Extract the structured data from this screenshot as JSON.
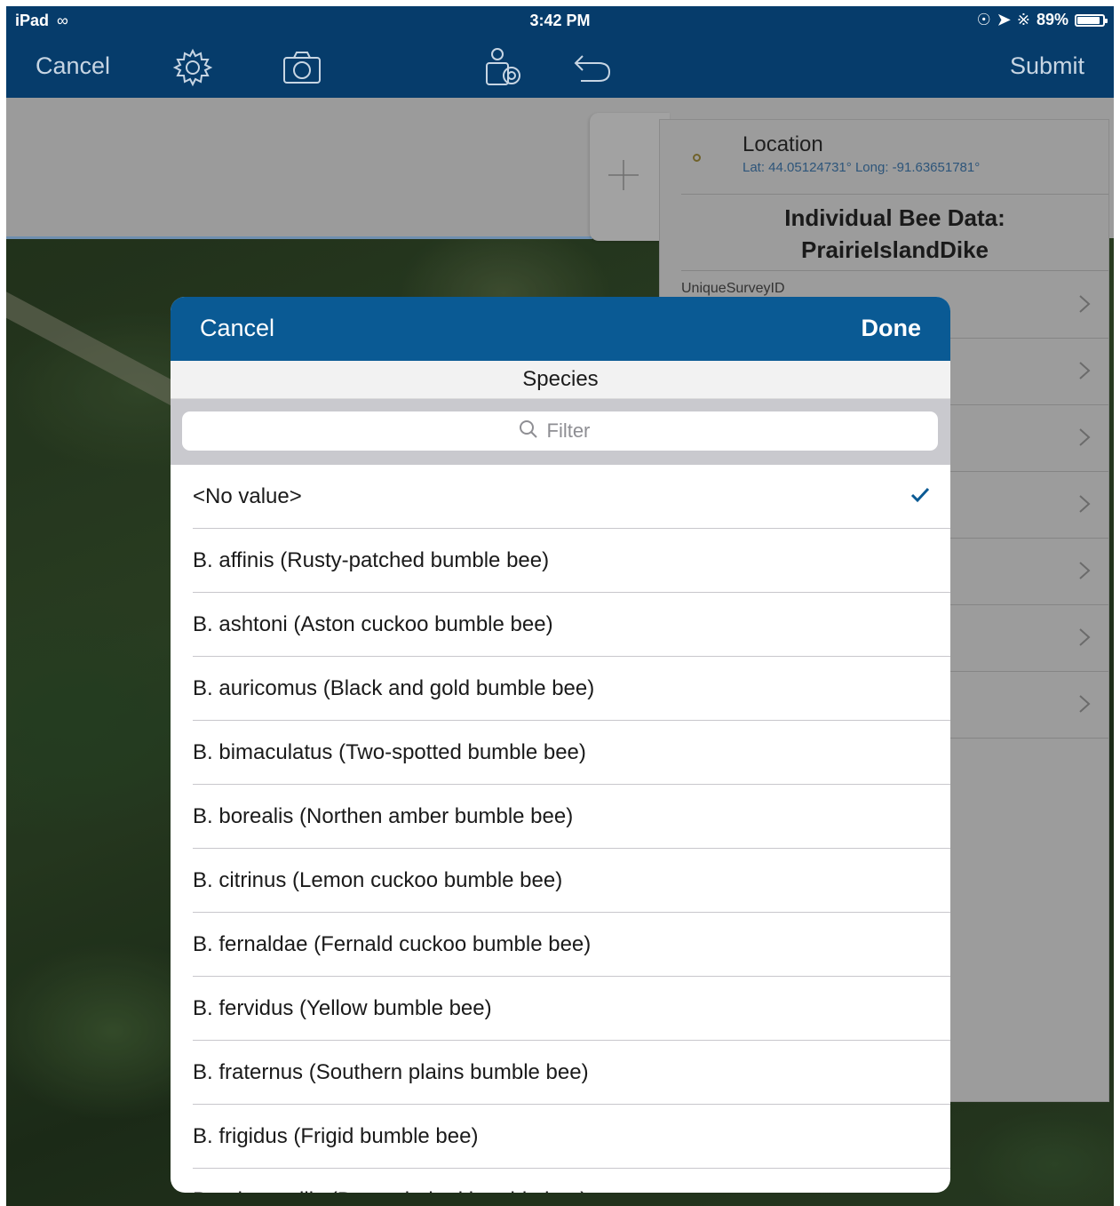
{
  "status_bar": {
    "device": "iPad",
    "time": "3:42 PM",
    "battery": "89%",
    "battery_level": 0.89
  },
  "nav": {
    "cancel": "Cancel",
    "submit": "Submit",
    "icons": [
      "gear-icon",
      "camera-icon",
      "collect-feature-icon",
      "undo-icon"
    ]
  },
  "panel": {
    "location_title": "Location",
    "location_coords": "Lat: 44.05124731° Long: -91.63651781°",
    "form_title_line1": "Individual Bee Data:",
    "form_title_line2": "PrairieIslandDike",
    "first_field_label": "UniqueSurveyID",
    "field_row_count": 7
  },
  "modal": {
    "cancel": "Cancel",
    "done": "Done",
    "title": "Species",
    "filter_placeholder": "Filter",
    "selected_index": 0,
    "options": [
      "<No value>",
      "B. affinis (Rusty-patched bumble bee)",
      "B. ashtoni (Aston cuckoo bumble bee)",
      "B. auricomus (Black and gold bumble bee)",
      "B. bimaculatus (Two-spotted bumble bee)",
      "B. borealis (Northen amber bumble bee)",
      "B. citrinus (Lemon cuckoo bumble bee)",
      "B. fernaldae (Fernald cuckoo bumble bee)",
      "B. fervidus (Yellow bumble bee)",
      "B. fraternus (Southern plains bumble bee)",
      "B. frigidus (Frigid bumble bee)",
      "B. griseocollis (Brown-belted bumble bee)"
    ]
  },
  "colors": {
    "nav_bg": "#063c6b",
    "modal_header_bg": "#0a5a94",
    "checkmark": "#0a5a94"
  }
}
